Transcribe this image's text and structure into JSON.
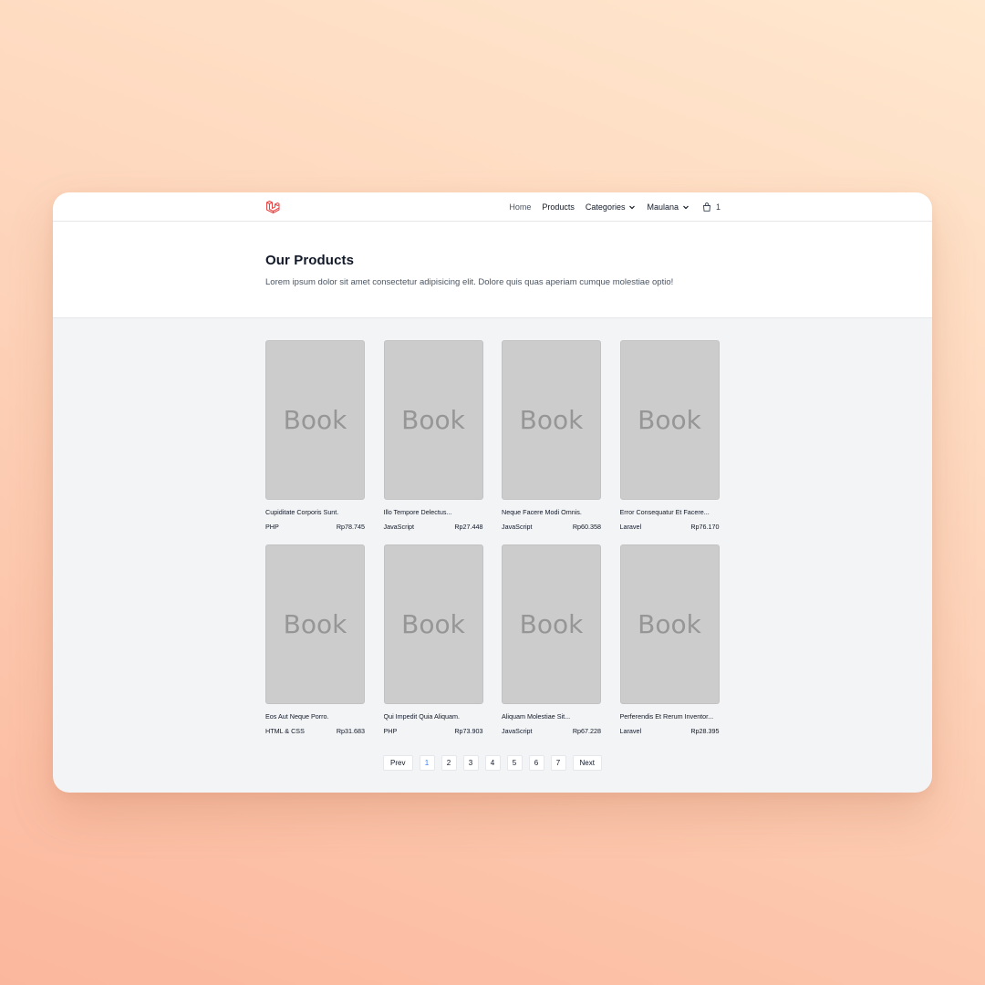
{
  "nav": {
    "items": [
      {
        "label": "Home",
        "name": "nav-home",
        "cls": "home"
      },
      {
        "label": "Products",
        "name": "nav-products",
        "cls": ""
      }
    ],
    "categories_label": "Categories",
    "user_label": "Maulana",
    "cart_count": "1"
  },
  "hero": {
    "title": "Our Products",
    "subtitle": "Lorem ipsum dolor sit amet consectetur adipisicing elit. Dolore quis quas aperiam cumque molestiae optio!"
  },
  "products": [
    {
      "cover": "Book",
      "title": "Cupiditate Corporis Sunt.",
      "category": "PHP",
      "price": "Rp78.745"
    },
    {
      "cover": "Book",
      "title": "Illo Tempore Delectus...",
      "category": "JavaScript",
      "price": "Rp27.448"
    },
    {
      "cover": "Book",
      "title": "Neque Facere Modi Omnis.",
      "category": "JavaScript",
      "price": "Rp60.358"
    },
    {
      "cover": "Book",
      "title": "Error Consequatur Et Facere...",
      "category": "Laravel",
      "price": "Rp76.170"
    },
    {
      "cover": "Book",
      "title": "Eos Aut Neque Porro.",
      "category": "HTML & CSS",
      "price": "Rp31.683"
    },
    {
      "cover": "Book",
      "title": "Qui Impedit Quia Aliquam.",
      "category": "PHP",
      "price": "Rp73.903"
    },
    {
      "cover": "Book",
      "title": "Aliquam Molestiae Sit...",
      "category": "JavaScript",
      "price": "Rp67.228"
    },
    {
      "cover": "Book",
      "title": "Perferendis Et Rerum Inventor...",
      "category": "Laravel",
      "price": "Rp28.395"
    }
  ],
  "pagination": {
    "prev": "Prev",
    "next": "Next",
    "pages": [
      "1",
      "2",
      "3",
      "4",
      "5",
      "6",
      "7"
    ],
    "current": "1"
  },
  "colors": {
    "logo": "#ef4444",
    "active_page": "#3b82f6"
  }
}
